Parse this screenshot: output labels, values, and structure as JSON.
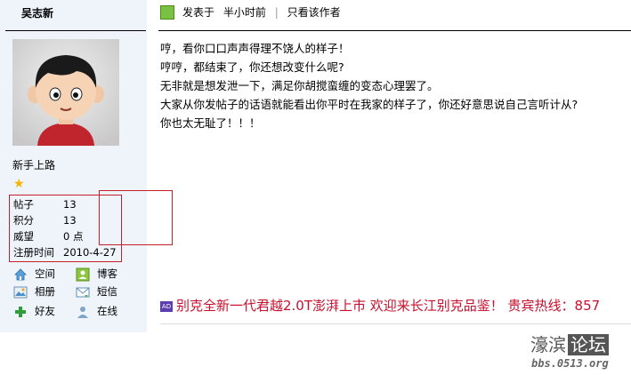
{
  "author": {
    "name": "吴志新",
    "rank": "新手上路",
    "stats": [
      {
        "label": "帖子",
        "value": "13"
      },
      {
        "label": "积分",
        "value": "13"
      },
      {
        "label": "威望",
        "value": "0 点"
      },
      {
        "label": "注册时间",
        "value": "2010-4-27"
      }
    ],
    "actions": [
      {
        "label": "空间",
        "icon": "home-icon"
      },
      {
        "label": "博客",
        "icon": "blog-icon"
      },
      {
        "label": "相册",
        "icon": "album-icon"
      },
      {
        "label": "短信",
        "icon": "message-icon"
      },
      {
        "label": "好友",
        "icon": "add-friend-icon"
      },
      {
        "label": "在线",
        "icon": "online-user-icon"
      }
    ]
  },
  "post": {
    "posted_prefix": "发表于",
    "posted_time": "半小时前",
    "separator": "|",
    "only_author_label": "只看该作者",
    "lines": [
      "哼，看你口口声声得理不饶人的样子！",
      "哼哼，都结束了，你还想改变什么呢?",
      "无非就是想发泄一下，满足你胡搅蛮缠的变态心理罢了。",
      "大家从你发帖子的话语就能看出你平时在我家的样子了，你还好意思说自己言听计从?",
      "你也太无耻了！！！"
    ],
    "ad_badge": "AD",
    "ad_text": "别克全新一代君越2.0T澎湃上市  欢迎来长江别克品鉴！  贵宾热线：857"
  },
  "watermark": {
    "name_plain": "濠滨",
    "name_boxed": "论坛",
    "url": "bbs.0513.org"
  },
  "colors": {
    "sidebar_bg": "#eef4fa",
    "highlight_red": "#c41f2a",
    "ad_red": "#c8102e"
  }
}
